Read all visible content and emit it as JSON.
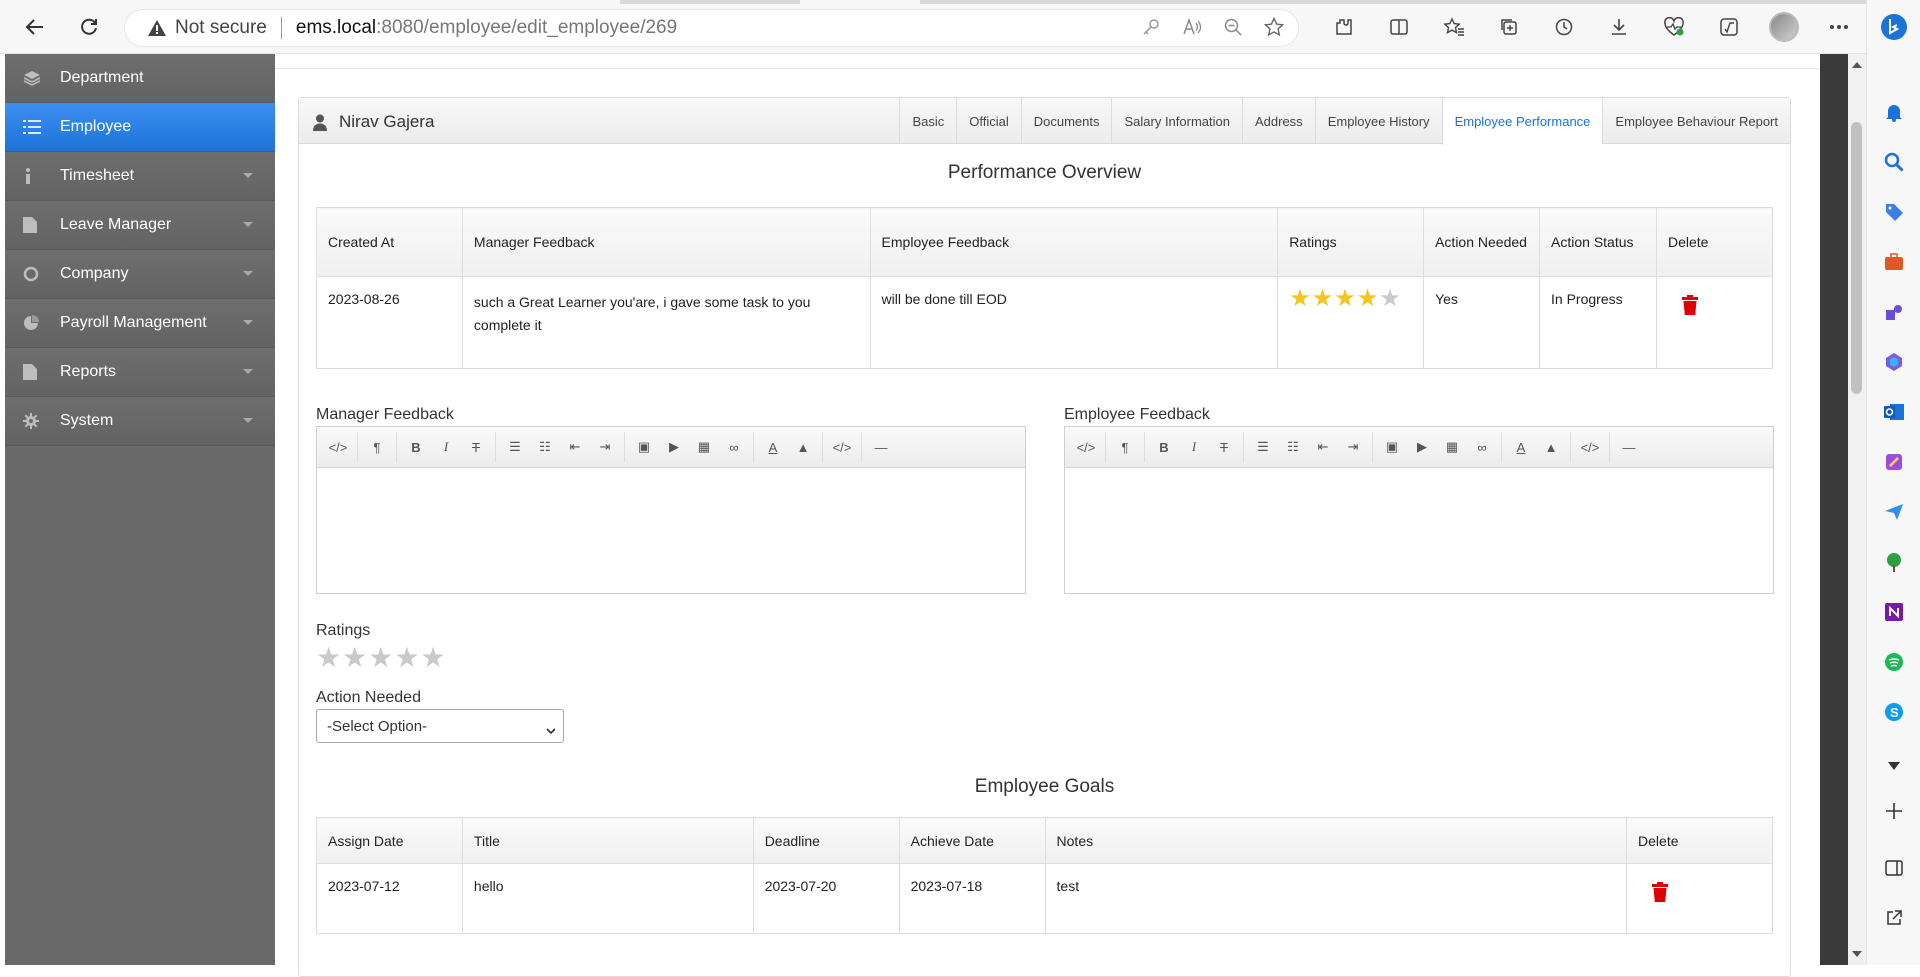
{
  "browser": {
    "security_label": "Not secure",
    "url_host": "ems.local",
    "url_path": ":8080/employee/edit_employee/269"
  },
  "sidebar": {
    "items": [
      {
        "label": "Department",
        "icon": "layers-icon"
      },
      {
        "label": "Employee",
        "icon": "list-icon"
      },
      {
        "label": "Timesheet",
        "icon": "info-icon"
      },
      {
        "label": "Leave Manager",
        "icon": "document-icon"
      },
      {
        "label": "Company",
        "icon": "refresh-icon"
      },
      {
        "label": "Payroll Management",
        "icon": "pie-chart-icon"
      },
      {
        "label": "Reports",
        "icon": "file-icon"
      },
      {
        "label": "System",
        "icon": "gear-icon"
      }
    ]
  },
  "panel": {
    "employee_name": "Nirav Gajera",
    "tabs": [
      "Basic",
      "Official",
      "Documents",
      "Salary Information",
      "Address",
      "Employee History",
      "Employee Performance",
      "Employee Behaviour Report"
    ],
    "active_tab": "Employee Performance"
  },
  "performance": {
    "title": "Performance Overview",
    "headers": [
      "Created At",
      "Manager Feedback",
      "Employee Feedback",
      "Ratings",
      "Action Needed",
      "Action Status",
      "Delete"
    ],
    "rows": [
      {
        "created_at": "2023-08-26",
        "manager_feedback": "such a Great Learner you'are, i gave some task to you complete it",
        "employee_feedback": "will be done till EOD",
        "rating": 4,
        "rating_max": 5,
        "action_needed": "Yes",
        "action_status": "In Progress"
      }
    ]
  },
  "form": {
    "manager_feedback_label": "Manager Feedback",
    "employee_feedback_label": "Employee Feedback",
    "ratings_label": "Ratings",
    "rating_value": 0,
    "action_needed_label": "Action Needed",
    "action_needed_value": "-Select Option-"
  },
  "goals": {
    "title": "Employee Goals",
    "headers": [
      "Assign Date",
      "Title",
      "Deadline",
      "Achieve Date",
      "Notes",
      "Delete"
    ],
    "rows": [
      {
        "assign_date": "2023-07-12",
        "title": "hello",
        "deadline": "2023-07-20",
        "achieve_date": "2023-07-18",
        "notes": "test"
      }
    ]
  },
  "colors": {
    "active_blue": "#1e73d8",
    "star_gold": "#f5c518",
    "delete_red": "#e00000"
  }
}
